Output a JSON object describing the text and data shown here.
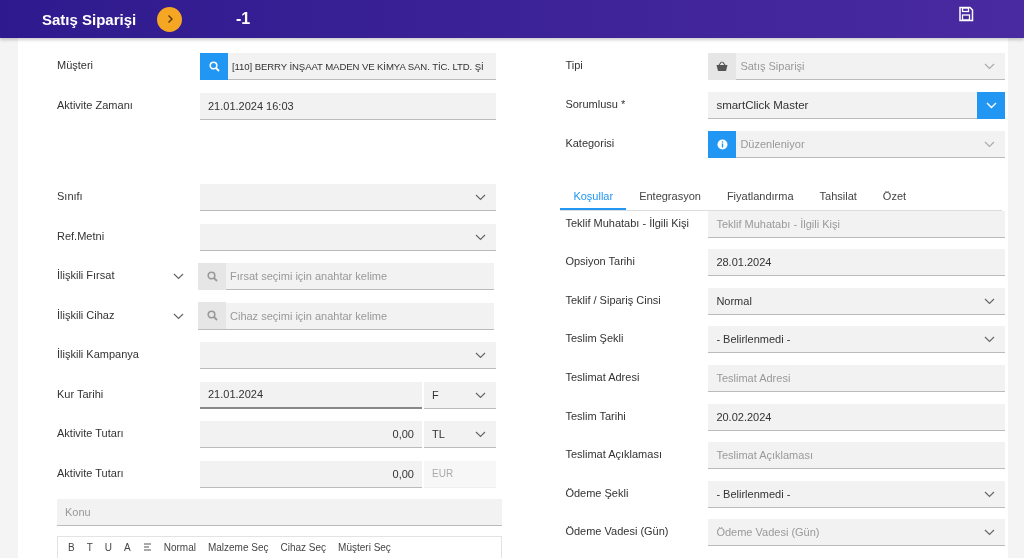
{
  "header": {
    "title": "Satış Siparişi",
    "record_number": "-1"
  },
  "left_top_fields": [
    {
      "label": "Müşteri",
      "kind": "lookup",
      "value": "[110] BERRY İNŞAAT MADEN VE KİMYA SAN. TİC. LTD. Şİ"
    },
    {
      "label": "Aktivite Zamanı",
      "kind": "text",
      "value": "21.01.2024 16:03"
    }
  ],
  "left_fields": [
    {
      "label": "Sınıfı",
      "kind": "select"
    },
    {
      "label": "Ref.Metni",
      "kind": "select"
    },
    {
      "label": "İlişkili Fırsat",
      "kind": "search",
      "placeholder": "Fırsat seçimi için anahtar kelime",
      "expanded": false
    },
    {
      "label": "İlişkili Cihaz",
      "kind": "search",
      "placeholder": "Cihaz seçimi için anahtar kelime",
      "expanded": false
    },
    {
      "label": "İlişkili Kampanya",
      "kind": "select"
    },
    {
      "label": "Kur Tarihi",
      "kind": "datesplit",
      "value": "21.01.2024",
      "side": "F",
      "side_disabled": false
    },
    {
      "label": "Aktivite Tutarı",
      "kind": "amountsplit",
      "value": "0,00",
      "side": "TL",
      "side_disabled": false
    },
    {
      "label": "Aktivite Tutarı",
      "kind": "amountsplit",
      "value": "0,00",
      "side": "EUR",
      "side_disabled": true
    }
  ],
  "subject": {
    "placeholder": "Konu"
  },
  "editor_toolbar": [
    {
      "kind": "text",
      "label": "B"
    },
    {
      "kind": "text",
      "label": "T"
    },
    {
      "kind": "text",
      "label": "U"
    },
    {
      "kind": "text",
      "label": "A"
    },
    {
      "kind": "icon"
    },
    {
      "kind": "text",
      "label": "Normal"
    },
    {
      "kind": "text",
      "label": "Malzeme Seç"
    },
    {
      "kind": "text",
      "label": "Cihaz Seç"
    },
    {
      "kind": "text",
      "label": "Müşteri Seç"
    }
  ],
  "right_top_fields": [
    {
      "label": "Tipi",
      "kind": "typepicker",
      "value": "Satış Siparişi",
      "disabled": true
    },
    {
      "label": "Sorumlusu *",
      "kind": "ownerpicker",
      "value": "smartClick Master",
      "disabled": false
    },
    {
      "label": "Kategorisi",
      "kind": "categorypicker",
      "value": "Düzenleniyor",
      "disabled": true
    }
  ],
  "tabs": [
    {
      "label": "Koşullar",
      "selected": true
    },
    {
      "label": "Entegrasyon",
      "selected": false
    },
    {
      "label": "Fiyatlandırma",
      "selected": false
    },
    {
      "label": "Tahsilat",
      "selected": false
    },
    {
      "label": "Özet",
      "selected": false
    }
  ],
  "right_fields": [
    {
      "label": "Teklif Muhatabı - İlgili Kişi",
      "kind": "text",
      "placeholder": "Teklif Muhatabı - İlgili Kişi"
    },
    {
      "label": "Opsiyon Tarihi",
      "kind": "text",
      "value": "28.01.2024"
    },
    {
      "label": "Teklif / Sipariş Cinsi",
      "kind": "select",
      "value": "Normal"
    },
    {
      "label": "Teslim Şekli",
      "kind": "select",
      "value": "- Belirlenmedi -"
    },
    {
      "label": "Teslimat Adresi",
      "kind": "text",
      "placeholder": "Teslimat Adresi"
    },
    {
      "label": "Teslim Tarihi",
      "kind": "text",
      "value": "20.02.2024"
    },
    {
      "label": "Teslimat Açıklaması",
      "kind": "text",
      "placeholder": "Teslimat Açıklaması"
    },
    {
      "label": "Ödeme Şekli",
      "kind": "select",
      "value": "- Belirlenmedi -"
    },
    {
      "label": "Ödeme Vadesi (Gün)",
      "kind": "select",
      "placeholder": "Ödeme Vadesi (Gün)"
    }
  ]
}
